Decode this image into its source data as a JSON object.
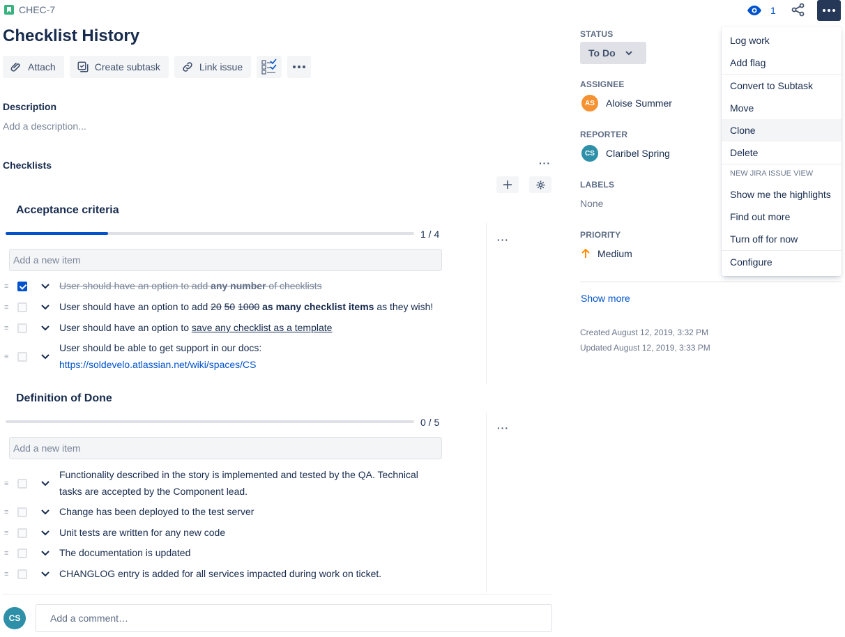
{
  "issue": {
    "key": "CHEC-7",
    "title": "Checklist History"
  },
  "toolbar": {
    "attach": "Attach",
    "create_subtask": "Create subtask",
    "link_issue": "Link issue"
  },
  "description": {
    "label": "Description",
    "placeholder": "Add a description..."
  },
  "checklists": {
    "label": "Checklists",
    "lists": [
      {
        "title": "Acceptance criteria",
        "count": "1 / 4",
        "progress": 0.25,
        "add_placeholder": "Add a new item",
        "items": [
          {
            "parts": [
              "User should have an option to add ",
              "any number",
              " of checklists"
            ],
            "checked": true
          },
          {
            "parts": [
              "User should have an option to add ",
              "20",
              " ",
              "50",
              " ",
              "1000",
              " ",
              "as many checklist items",
              " as they wish!"
            ],
            "checked": false
          },
          {
            "parts": [
              "User should have an option to ",
              "save any checklist as a template"
            ],
            "checked": false
          },
          {
            "parts": [
              "User should be able to get support in our docs:",
              "https://soldevelo.atlassian.net/wiki/spaces/CS"
            ],
            "checked": false
          }
        ]
      },
      {
        "title": "Definition of Done",
        "count": "0 / 5",
        "progress": 0,
        "add_placeholder": "Add a new item",
        "items": [
          {
            "parts": [
              "Functionality described in the story is implemented and tested by the QA. Technical",
              "tasks are accepted by the Component lead."
            ],
            "checked": false
          },
          {
            "parts": [
              "Change has been deployed to the test server"
            ],
            "checked": false
          },
          {
            "parts": [
              "Unit tests are written for any new code"
            ],
            "checked": false
          },
          {
            "parts": [
              "The documentation is updated"
            ],
            "checked": false
          },
          {
            "parts": [
              "CHANGLOG entry is added for all services impacted during work on ticket."
            ],
            "checked": false
          }
        ]
      }
    ]
  },
  "comment": {
    "avatar": "CS",
    "placeholder": "Add a comment…"
  },
  "sidebar": {
    "status_label": "STATUS",
    "status_value": "To Do",
    "assignee_label": "ASSIGNEE",
    "assignee_initials": "AS",
    "assignee_name": "Aloise Summer",
    "reporter_label": "REPORTER",
    "reporter_initials": "CS",
    "reporter_name": "Claribel Spring",
    "labels_label": "LABELS",
    "labels_value": "None",
    "priority_label": "PRIORITY",
    "priority_value": "Medium",
    "show_more": "Show more",
    "created": "Created August 12, 2019, 3:32 PM",
    "updated": "Updated August 12, 2019, 3:33 PM"
  },
  "header_actions": {
    "watchers": "1"
  },
  "menu": {
    "log_work": "Log work",
    "add_flag": "Add flag",
    "convert": "Convert to Subtask",
    "move": "Move",
    "clone": "Clone",
    "delete": "Delete",
    "group_label": "NEW JIRA ISSUE VIEW",
    "show_highlights": "Show me the highlights",
    "find_out_more": "Find out more",
    "turn_off": "Turn off for now",
    "configure": "Configure"
  },
  "colors": {
    "primary": "#0052CC",
    "text": "#172B4D",
    "assignee_avatar": "#F79232",
    "reporter_avatar": "#2D8FA8",
    "priority": "#FF8B00",
    "story": "#36B37E"
  }
}
